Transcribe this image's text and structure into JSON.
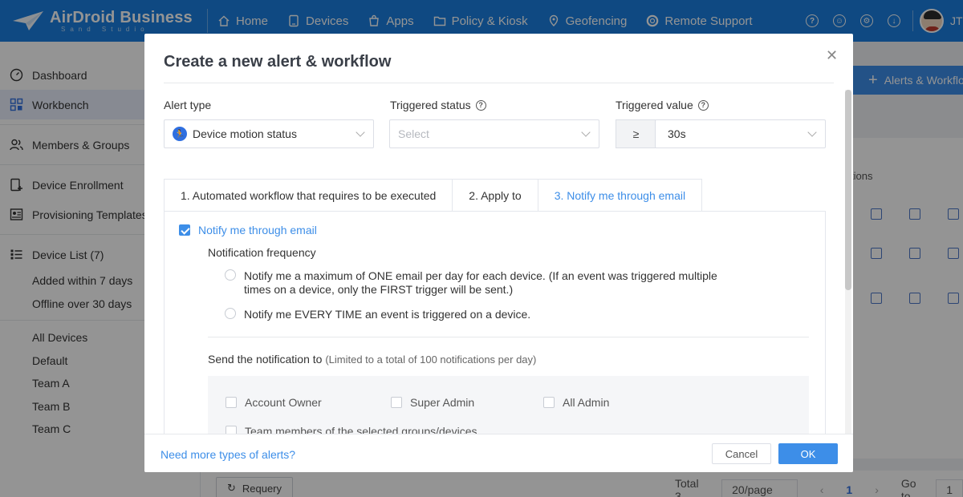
{
  "app": {
    "brand_name": "AirDroid Business",
    "brand_sub": "Sand Studio",
    "user_name": "JT"
  },
  "topnav": {
    "items": [
      {
        "label": "Home",
        "icon": "home-icon"
      },
      {
        "label": "Devices",
        "icon": "devices-icon"
      },
      {
        "label": "Apps",
        "icon": "apps-icon"
      },
      {
        "label": "Policy & Kiosk",
        "icon": "folder-icon"
      },
      {
        "label": "Geofencing",
        "icon": "location-icon"
      },
      {
        "label": "Remote Support",
        "icon": "lifebuoy-icon"
      }
    ],
    "right_icons": [
      "help-icon",
      "support-agent-icon",
      "settings-icon",
      "download-icon"
    ]
  },
  "sidebar": {
    "dashboard": "Dashboard",
    "workbench": "Workbench",
    "members_groups": "Members & Groups",
    "device_enrollment": "Device Enrollment",
    "provisioning_templates": "Provisioning Templates",
    "device_list": "Device List (7)",
    "device_filters": [
      "Added within 7 days",
      "Offline over 30 days"
    ],
    "groups": [
      "All Devices",
      "Default",
      "Team A",
      "Team B",
      "Team C"
    ]
  },
  "background": {
    "add_button": "Alerts & Workflows",
    "actions_header": "tions",
    "requery": "Requery",
    "pager": {
      "total": "Total 3",
      "page_size": "20/page",
      "current_page": "1",
      "goto_label": "Go to",
      "goto_value": "1"
    }
  },
  "modal": {
    "title": "Create a new alert & workflow",
    "alert_type": {
      "label": "Alert type",
      "value": "Device motion status"
    },
    "triggered_status": {
      "label": "Triggered status",
      "placeholder": "Select"
    },
    "triggered_value": {
      "label": "Triggered value",
      "operator": "≥",
      "value": "30s"
    },
    "tabs": [
      {
        "label": "1. Automated workflow that requires to be executed",
        "active": false
      },
      {
        "label": "2. Apply to",
        "active": false
      },
      {
        "label": "3. Notify me through email",
        "active": true
      }
    ],
    "notify_checkbox": {
      "label": "Notify me through email",
      "checked": true
    },
    "frequency_label": "Notification frequency",
    "frequency_options": [
      {
        "line1": "Notify me a maximum of ONE email per day for each device. (If an event was triggered multiple",
        "line2": "times on a device, only the FIRST trigger will be sent.)"
      },
      {
        "line1": "Notify me EVERY TIME an event is triggered on a device.",
        "line2": ""
      }
    ],
    "send_label": "Send the notification to",
    "send_limit": "(Limited to a total of 100 notifications per day)",
    "recipients": [
      "Account Owner",
      "Super Admin",
      "All Admin",
      "Team members of the selected groups/devices"
    ],
    "footer": {
      "more_link": "Need more types of alerts?",
      "cancel": "Cancel",
      "ok": "OK"
    }
  }
}
